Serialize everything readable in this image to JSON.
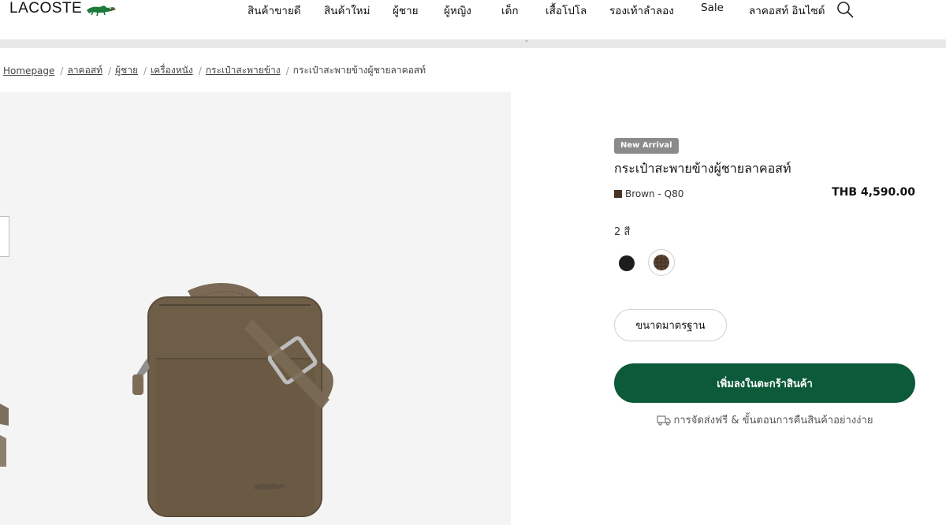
{
  "header": {
    "logo_text": "LACOSTE",
    "logo_icon": "crocodile-logo",
    "nav": [
      {
        "label": "สินค้าขายดี"
      },
      {
        "label": "สินค้าใหม่"
      },
      {
        "label": "ผู้ชาย"
      },
      {
        "label": "ผู้หญิง"
      },
      {
        "label": "เด็ก"
      },
      {
        "label": "เสื้อโปโล"
      },
      {
        "label": "รองเท้าลำลอง"
      },
      {
        "label": "Sale"
      },
      {
        "label": "ลาคอสท์ อินไซด์"
      }
    ],
    "search_icon": "search-icon",
    "banner_mark": "\""
  },
  "breadcrumb": {
    "links": [
      {
        "label": "Homepage"
      },
      {
        "label": "ลาคอสท์"
      },
      {
        "label": "ผู้ชาย"
      },
      {
        "label": "เครื่องหนัง"
      },
      {
        "label": "กระเป๋าสะพายข้าง"
      }
    ],
    "current": "กระเป๋าสะพายข้างผู้ชายลาคอสท์",
    "separator": "/"
  },
  "product": {
    "badge": "New Arrival",
    "title": "กระเป๋าสะพายข้างผู้ชายลาคอสท์",
    "color_name": "Brown - Q80",
    "price": "THB 4,590.00",
    "color_count": "2 สี",
    "colors": [
      {
        "name": "black",
        "hex": "#1d1d1d"
      },
      {
        "name": "brown",
        "hex": "#5a4433",
        "selected": true
      }
    ],
    "size_label": "ขนาดมาตรฐาน",
    "add_to_cart": "เพิ่มลงในตะกร้าสินค้า",
    "shipping_text": "การจัดส่งฟรี & ขั้นตอนการคืนสินค้าอย่างง่าย",
    "accent_color": "#0d5a3a",
    "badge_color": "#8b8b8b"
  }
}
